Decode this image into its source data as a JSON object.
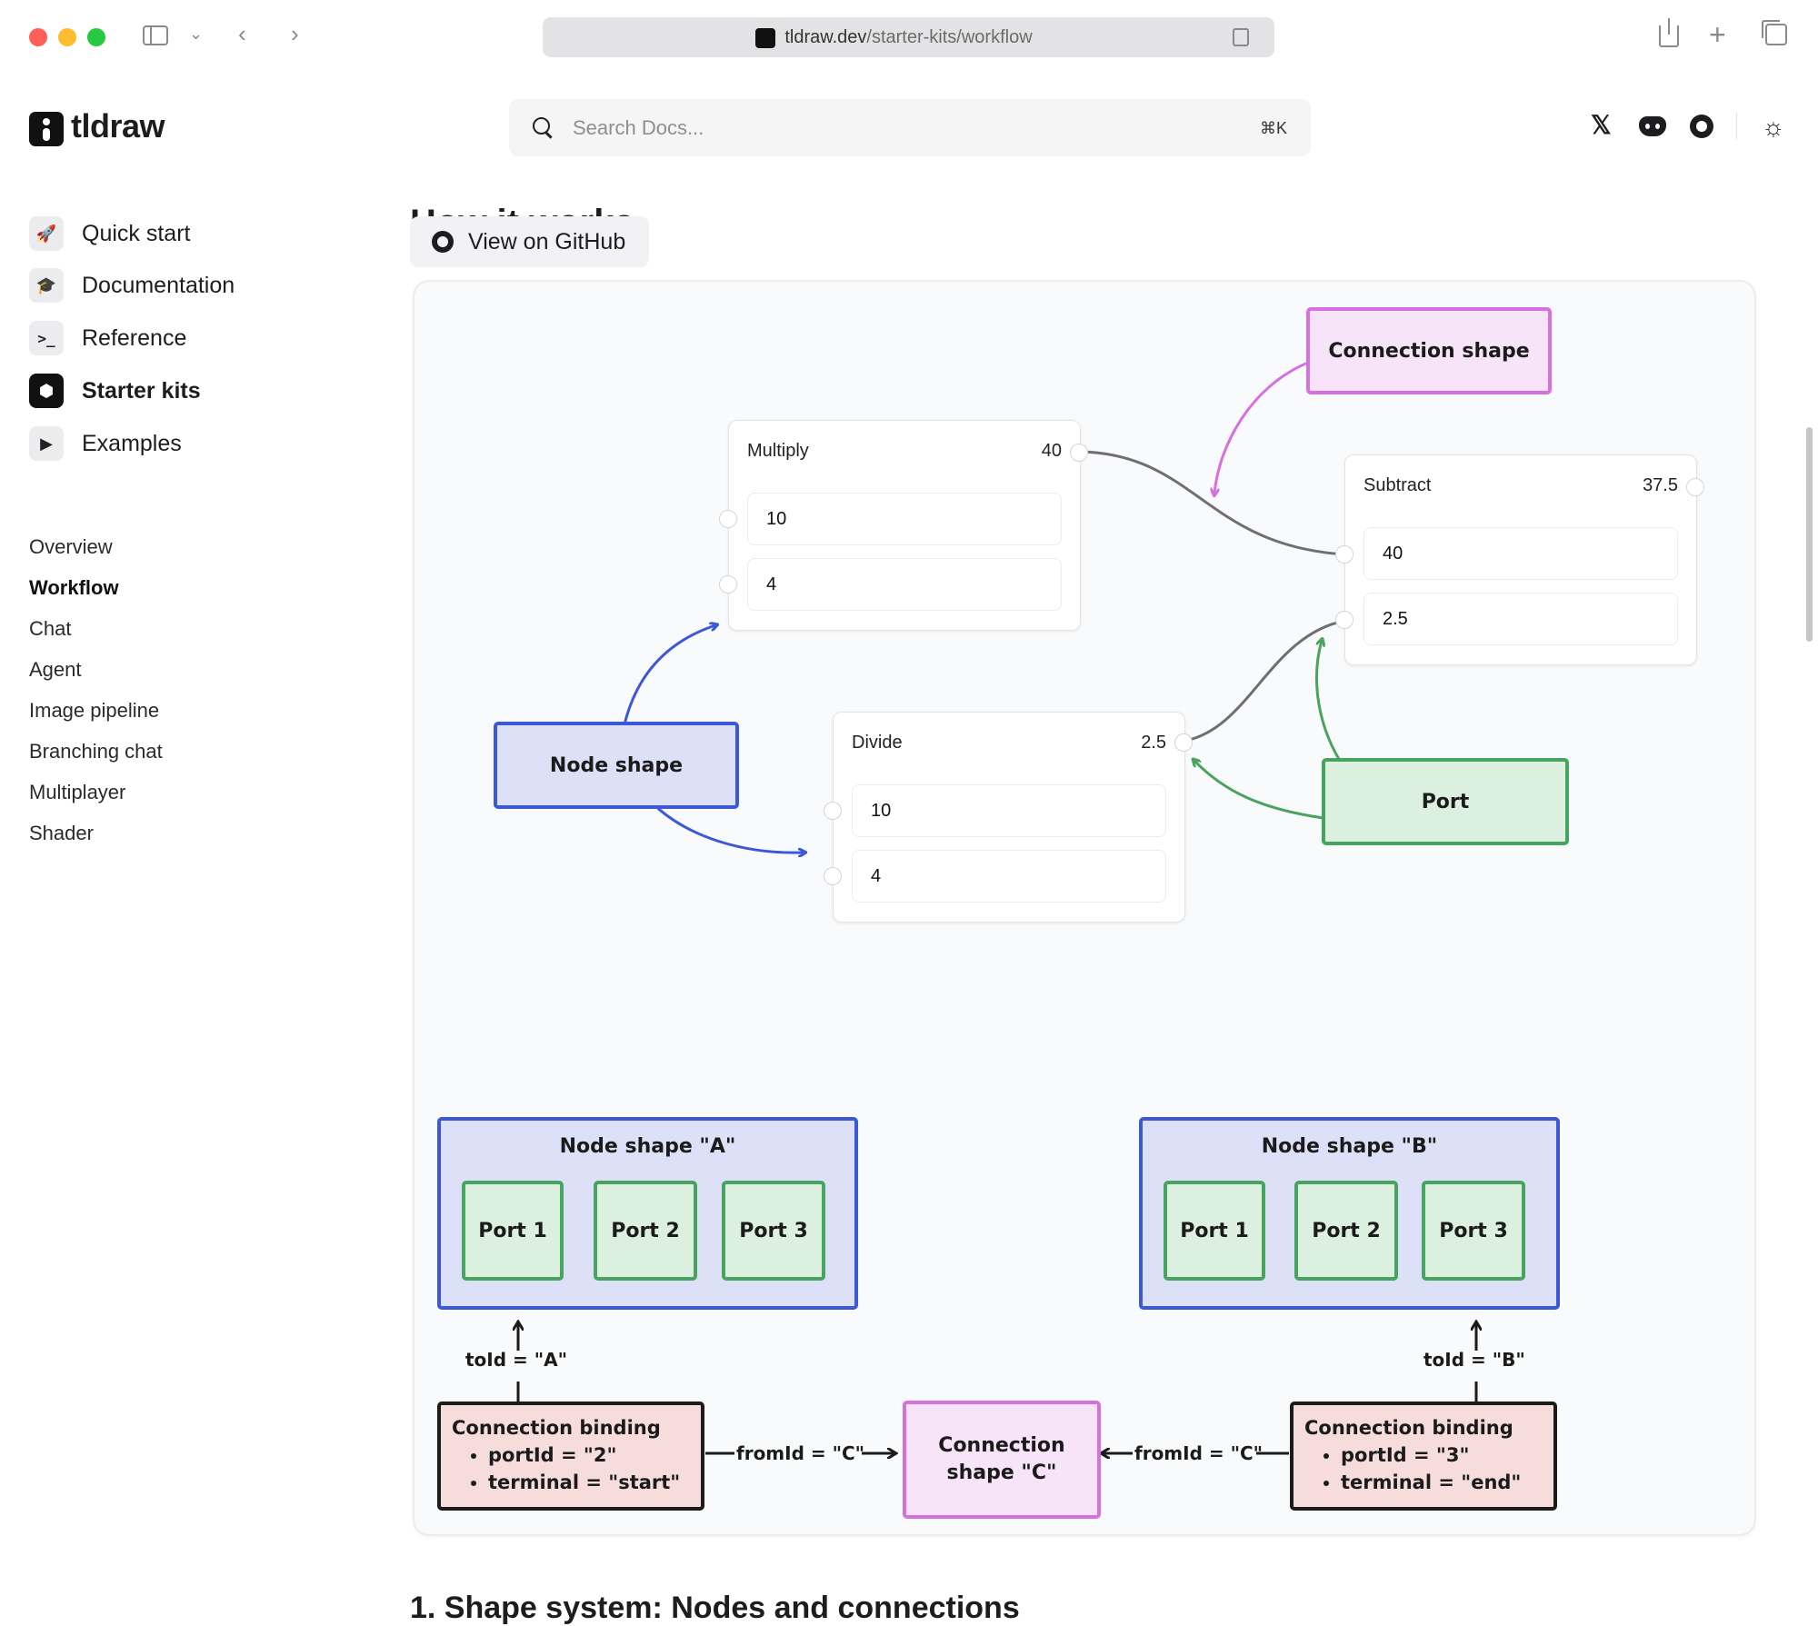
{
  "browser": {
    "url_domain": "tldraw.dev",
    "url_path": "/starter-kits/workflow"
  },
  "header": {
    "logo_text": "tldraw",
    "search_placeholder": "Search Docs...",
    "search_shortcut": "⌘K"
  },
  "sidebar": {
    "main": [
      {
        "label": "Quick start",
        "icon": "rocket-icon"
      },
      {
        "label": "Documentation",
        "icon": "graduation-cap-icon"
      },
      {
        "label": "Reference",
        "icon": "terminal-icon"
      },
      {
        "label": "Starter kits",
        "icon": "box-icon",
        "active": true
      },
      {
        "label": "Examples",
        "icon": "play-icon"
      }
    ],
    "sub": [
      "Overview",
      "Workflow",
      "Chat",
      "Agent",
      "Image pipeline",
      "Branching chat",
      "Multiplayer",
      "Shader"
    ],
    "sub_active": "Workflow"
  },
  "content": {
    "section_heading": "How it works",
    "github_button": "View on GitHub",
    "next_heading": "1. Shape system: Nodes and connections"
  },
  "diagram": {
    "multiply": {
      "title": "Multiply",
      "value": "40",
      "inputs": [
        "10",
        "4"
      ]
    },
    "subtract": {
      "title": "Subtract",
      "value": "37.5",
      "inputs": [
        "40",
        "2.5"
      ]
    },
    "divide": {
      "title": "Divide",
      "value": "2.5",
      "inputs": [
        "10",
        "4"
      ]
    },
    "label_connection_shape": "Connection shape",
    "label_node_shape": "Node shape",
    "label_port": "Port"
  },
  "bindings": {
    "node_a_title": "Node shape \"A\"",
    "node_b_title": "Node shape \"B\"",
    "ports": [
      "Port 1",
      "Port 2",
      "Port 3"
    ],
    "binding_left": {
      "title": "Connection binding",
      "lines": [
        "portId = \"2\"",
        "terminal = \"start\""
      ]
    },
    "binding_right": {
      "title": "Connection binding",
      "lines": [
        "portId = \"3\"",
        "terminal = \"end\""
      ]
    },
    "connection_shape_c": [
      "Connection",
      "shape \"C\""
    ],
    "to_id_a": "toId = \"A\"",
    "to_id_b": "toId = \"B\"",
    "from_id_left": "fromId = \"C\"",
    "from_id_right": "fromId = \"C\""
  },
  "colors": {
    "blue": "#3d58d6",
    "pink": "#d670e0",
    "green": "#47a35e",
    "red": "#e05a5a"
  }
}
